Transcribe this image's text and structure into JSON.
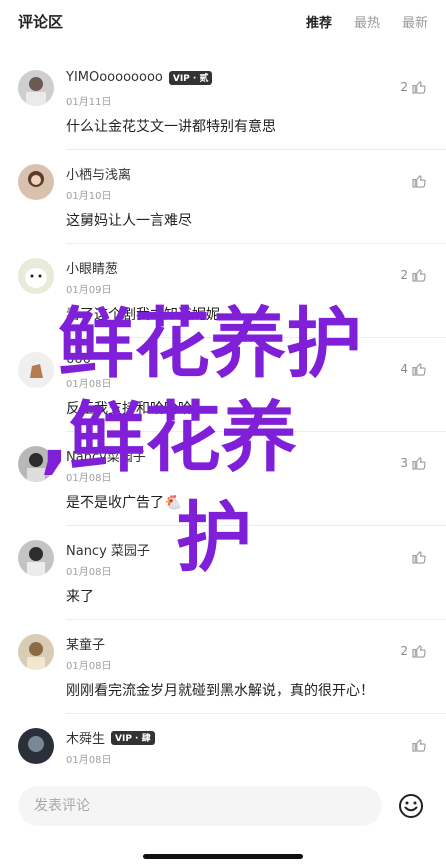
{
  "header": {
    "title": "评论区",
    "tabs": [
      {
        "label": "推荐",
        "active": true
      },
      {
        "label": "最热",
        "active": false
      },
      {
        "label": "最新",
        "active": false
      }
    ]
  },
  "comments": [
    {
      "user": "YIMOoooooooo",
      "vip": "VIP · 贰",
      "date": "01月11日",
      "text": "什么让金花艾文一讲都特别有意思",
      "likes": "2"
    },
    {
      "user": "小栖与浅离",
      "vip": "",
      "date": "01月10日",
      "text": "这舅妈让人一言难尽",
      "likes": ""
    },
    {
      "user": "小眼睛葱",
      "vip": "",
      "date": "01月09日",
      "text": "看了这个剧我才知道妮妮",
      "likes": "2"
    },
    {
      "user": "666",
      "vip": "",
      "date": "01月08日",
      "text": "反正我支持和哈哈哈",
      "likes": "4"
    },
    {
      "user": "Nancy菜园子",
      "vip": "",
      "date": "01月08日",
      "text": "是不是收广告了🐔",
      "likes": "3"
    },
    {
      "user": "Nancy 菜园子",
      "vip": "",
      "date": "01月08日",
      "text": "来了",
      "likes": ""
    },
    {
      "user": "某童子",
      "vip": "",
      "date": "01月08日",
      "text": "刚刚看完流金岁月就碰到黑水解说，真的很开心！",
      "likes": "2"
    },
    {
      "user": "木舜生",
      "vip": "VIP · 肆",
      "date": "01月08日",
      "text": "",
      "likes": ""
    }
  ],
  "overlay": {
    "line1": "鲜花养护",
    "line2": ",鲜花养",
    "line3": "护"
  },
  "footer": {
    "placeholder": "发表评论"
  },
  "colors": {
    "overlay": "#7f1fd8",
    "vip_bg": "#333333"
  },
  "icons": {
    "like": "thumbs-up-icon",
    "emoji": "smiley-icon"
  }
}
